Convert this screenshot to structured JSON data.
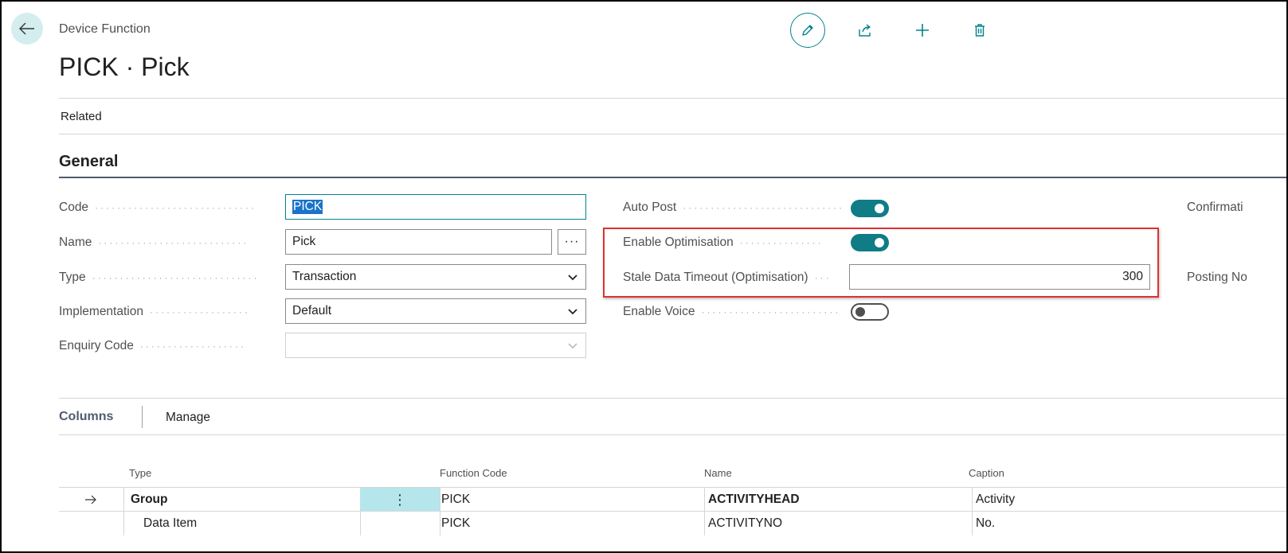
{
  "header": {
    "caption": "Device Function",
    "title": "PICK · Pick"
  },
  "actions": {
    "edit": "edit-icon",
    "share": "share-icon",
    "new": "plus-icon",
    "delete": "trash-icon"
  },
  "nav": {
    "related": "Related"
  },
  "general": {
    "section_title": "General",
    "code": {
      "label": "Code",
      "value": "PICK"
    },
    "name": {
      "label": "Name",
      "value": "Pick",
      "assist": "···"
    },
    "type": {
      "label": "Type",
      "value": "Transaction"
    },
    "implementation": {
      "label": "Implementation",
      "value": "Default"
    },
    "enquiry_code": {
      "label": "Enquiry Code",
      "value": ""
    },
    "auto_post": {
      "label": "Auto Post",
      "on": true
    },
    "enable_optimisation": {
      "label": "Enable Optimisation",
      "on": true
    },
    "stale_timeout": {
      "label": "Stale Data Timeout (Optimisation)",
      "value": "300"
    },
    "enable_voice": {
      "label": "Enable Voice",
      "on": false
    },
    "confirmation": {
      "label": "Confirmati"
    },
    "posting": {
      "label": "Posting No"
    }
  },
  "columns": {
    "title": "Columns",
    "manage": "Manage",
    "headers": {
      "type": "Type",
      "function_code": "Function Code",
      "name": "Name",
      "caption": "Caption"
    },
    "rows": [
      {
        "type": "Group",
        "function_code": "PICK",
        "name": "ACTIVITYHEAD",
        "caption": "Activity"
      },
      {
        "type": "Data Item",
        "function_code": "PICK",
        "name": "ACTIVITYNO",
        "caption": "No."
      }
    ]
  },
  "colors": {
    "accent": "#00838f",
    "highlight": "#e03030",
    "selection": "#1a73c9"
  }
}
